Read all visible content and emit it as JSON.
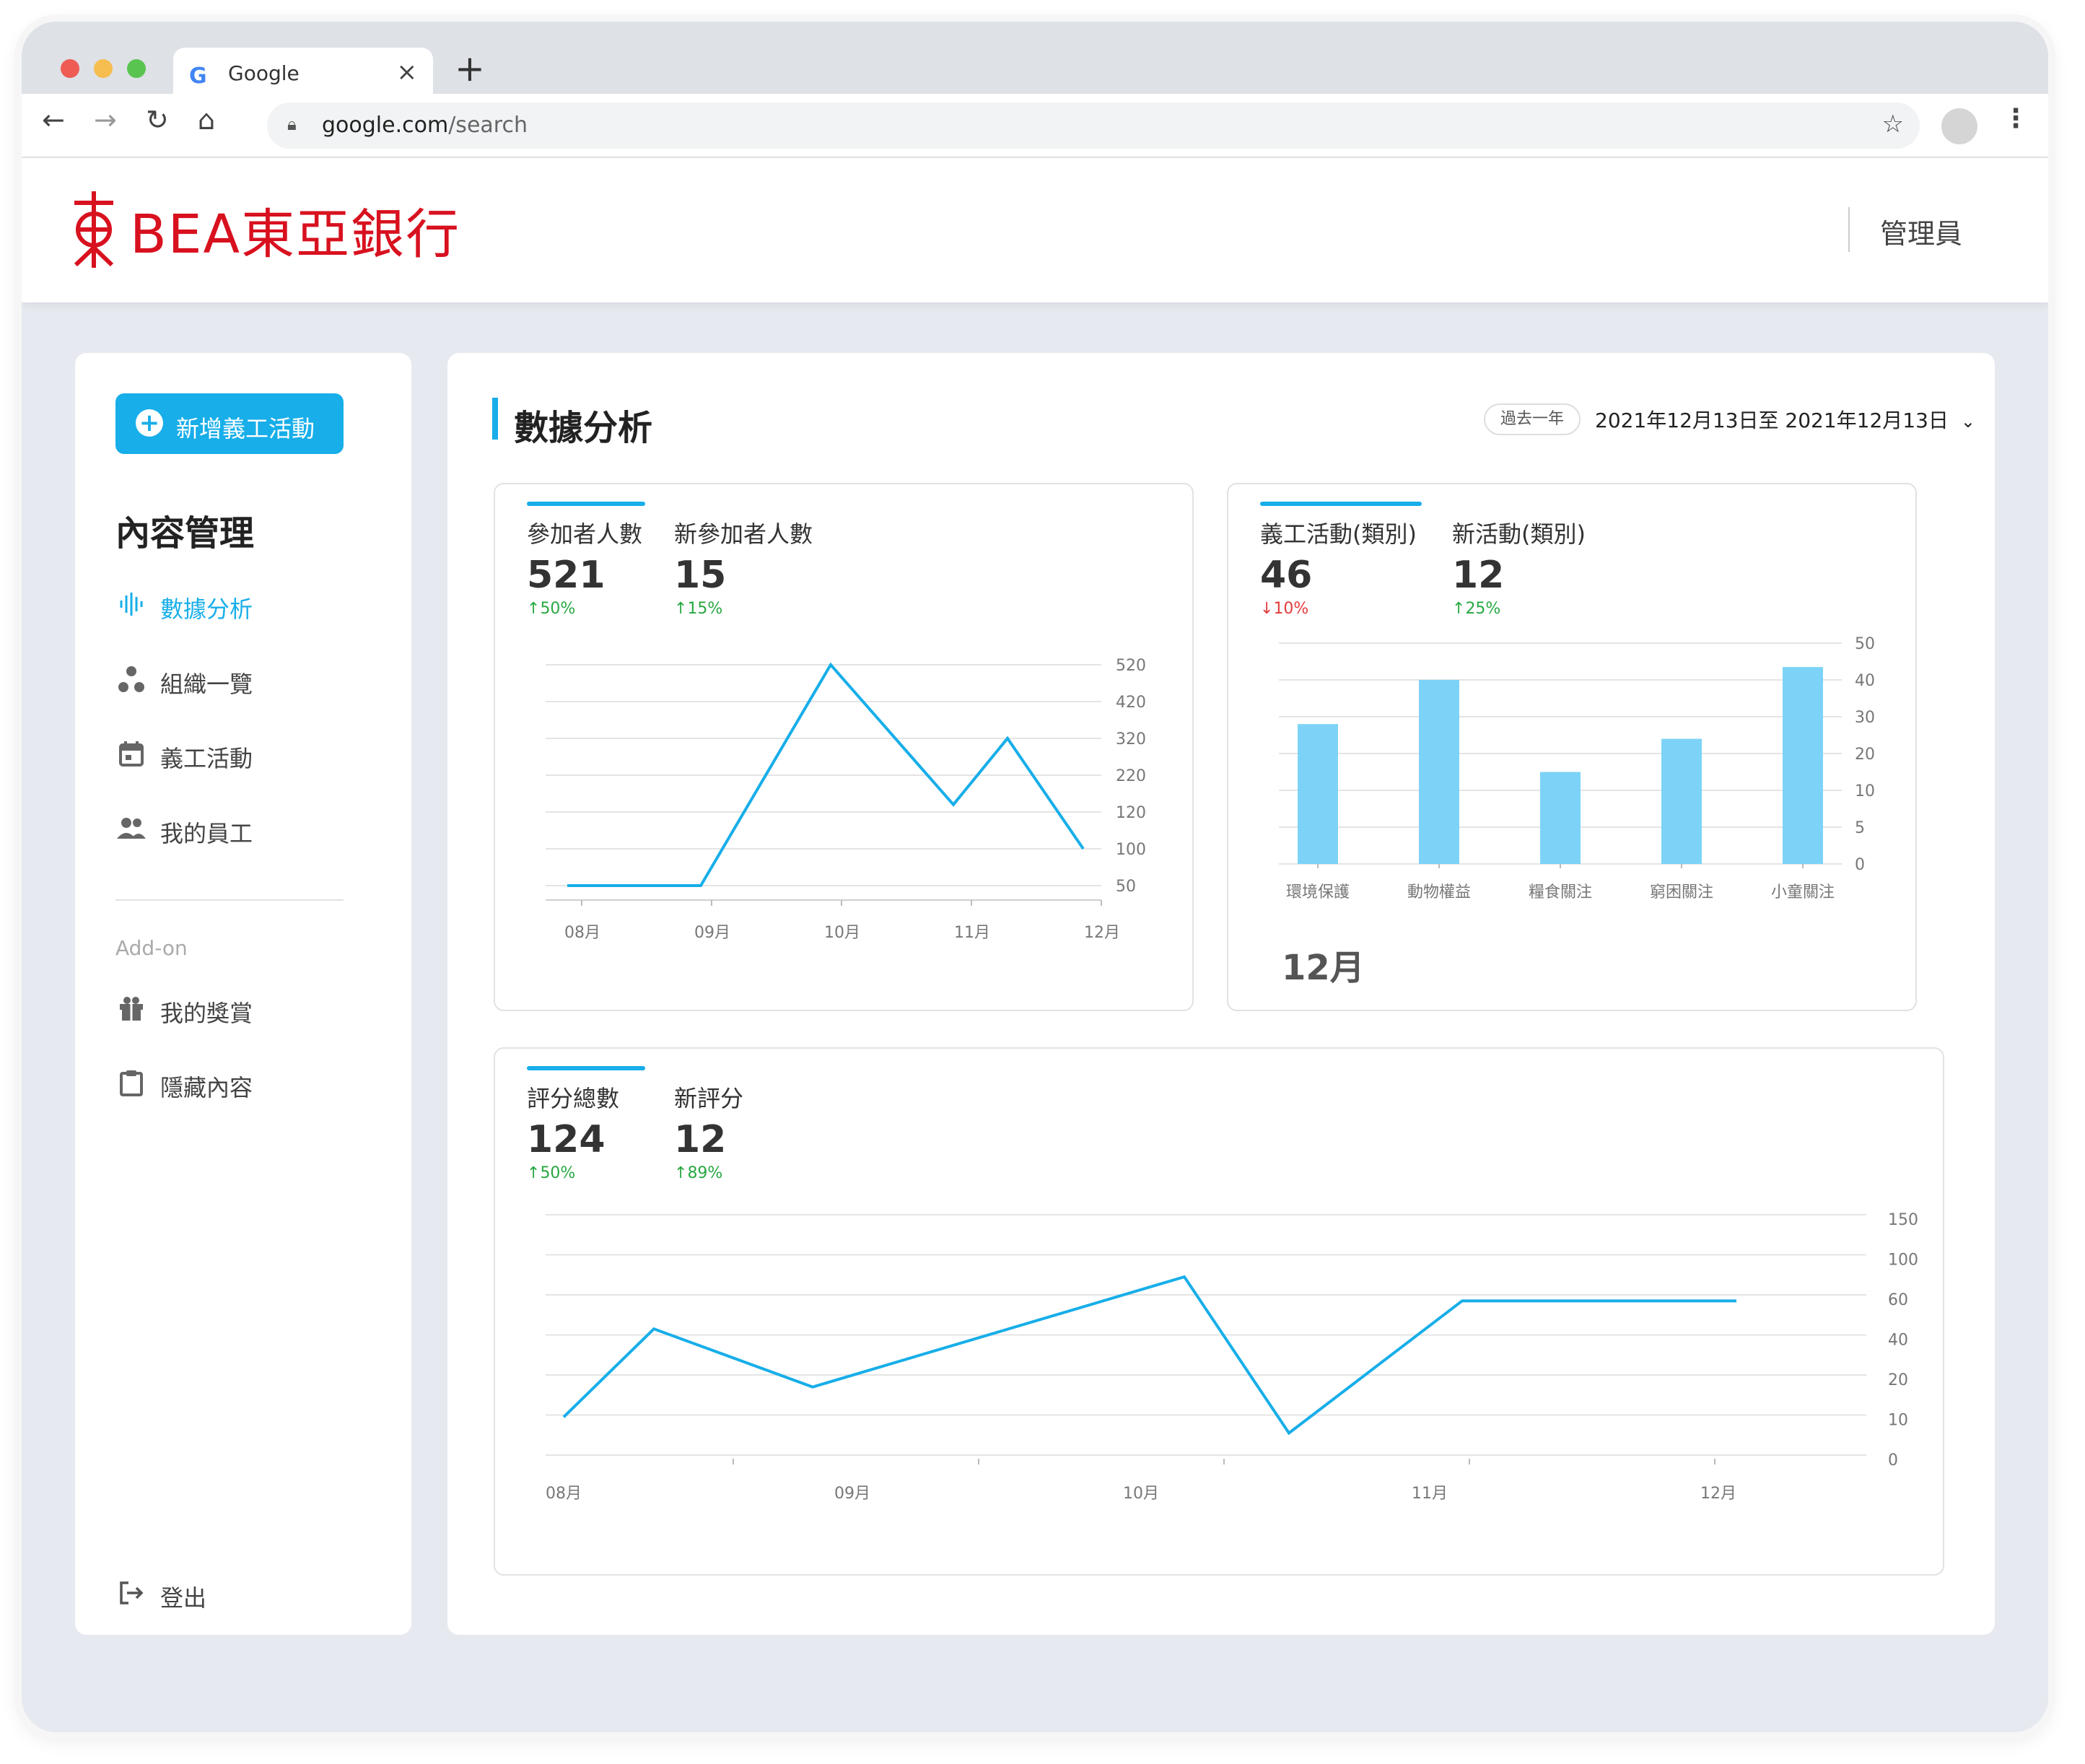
{
  "browser": {
    "tab_title": "Google",
    "url_domain": "google.com",
    "url_path": "/search",
    "tab_close": "×",
    "new_tab": "+"
  },
  "header": {
    "bank_name": "BEA東亞銀行",
    "role": "管理員",
    "brand_color": "#d8111f"
  },
  "sidebar": {
    "add_button": "新增義工活動",
    "section_title": "內容管理",
    "items": [
      {
        "label": "數據分析",
        "icon": "analytics-icon",
        "active": true
      },
      {
        "label": "組織一覽",
        "icon": "organization-icon",
        "active": false
      },
      {
        "label": "義工活動",
        "icon": "calendar-icon",
        "active": false
      },
      {
        "label": "我的員工",
        "icon": "people-icon",
        "active": false
      }
    ],
    "addon_label": "Add-on",
    "addon_items": [
      {
        "label": "我的獎賞",
        "icon": "gift-icon"
      },
      {
        "label": "隱藏內容",
        "icon": "clipboard-icon"
      }
    ],
    "logout": "登出"
  },
  "main": {
    "title": "數據分析",
    "range_pill": "過去一年",
    "date_range": "2021年12月13日至 2021年12月13日"
  },
  "cards": {
    "participants": {
      "stats": [
        {
          "label": "參加者人數",
          "value": "521",
          "change": "50%",
          "dir": "up"
        },
        {
          "label": "新參加者人數",
          "value": "15",
          "change": "15%",
          "dir": "up"
        }
      ]
    },
    "activities": {
      "stats": [
        {
          "label": "義工活動(類別)",
          "value": "46",
          "change": "10%",
          "dir": "down"
        },
        {
          "label": "新活動(類別)",
          "value": "12",
          "change": "25%",
          "dir": "up"
        }
      ],
      "month": "12月"
    },
    "ratings": {
      "stats": [
        {
          "label": "評分總數",
          "value": "124",
          "change": "50%",
          "dir": "up"
        },
        {
          "label": "新評分",
          "value": "12",
          "change": "89%",
          "dir": "up"
        }
      ]
    }
  },
  "chart_data": [
    {
      "type": "line",
      "x": [
        "08月",
        "09月",
        "10月",
        "11月",
        "12月"
      ],
      "y_ticks": [
        "520",
        "420",
        "320",
        "220",
        "120",
        "100",
        "50"
      ],
      "series": [
        {
          "points": [
            [
              "08月",
              0.0
            ],
            [
              "09月",
              0.0
            ],
            [
              "10月",
              6.0
            ],
            [
              "11月",
              2.2
            ],
            [
              "11月+",
              4.0
            ],
            [
              "12月",
              1.0
            ]
          ]
        }
      ],
      "color": "#17aee9"
    },
    {
      "type": "bar",
      "categories": [
        "環境保護",
        "動物權益",
        "糧食關注",
        "窮困關注",
        "小童關注"
      ],
      "y_ticks": [
        "50",
        "40",
        "30",
        "20",
        "10",
        "5",
        "0"
      ],
      "values": [
        3.8,
        5.0,
        2.5,
        3.4,
        5.35
      ],
      "color": "#7dd3f7"
    },
    {
      "type": "line",
      "x": [
        "08月",
        "09月",
        "10月",
        "11月",
        "12月"
      ],
      "y_ticks": [
        "150",
        "100",
        "60",
        "40",
        "20",
        "10",
        "0"
      ],
      "series": [
        {
          "points": [
            0.95,
            3.15,
            1.7,
            4.45,
            0.55,
            3.85,
            3.85
          ]
        }
      ],
      "color": "#17aee9"
    }
  ]
}
